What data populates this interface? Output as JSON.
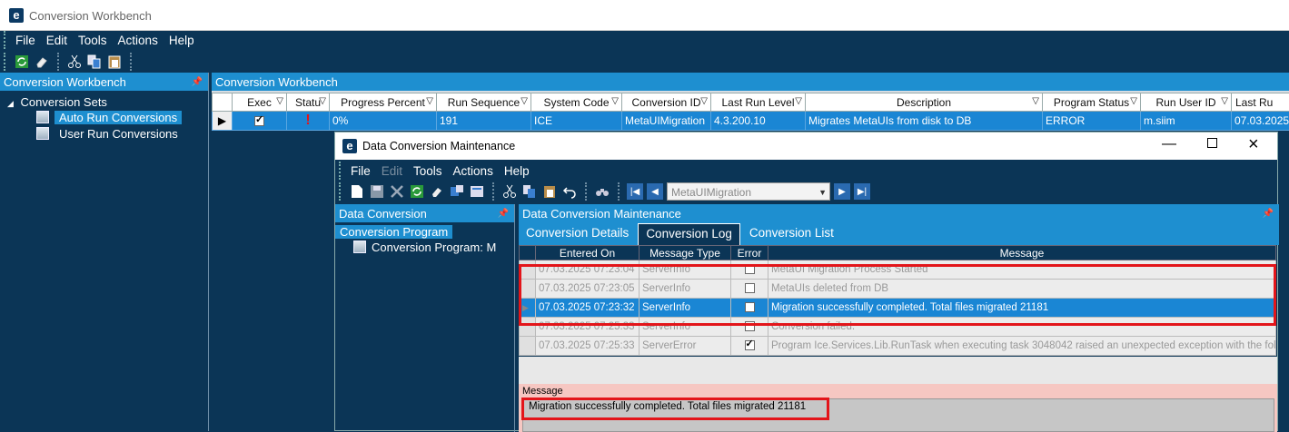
{
  "window": {
    "logo": "e",
    "title": "Conversion Workbench"
  },
  "menu": [
    "File",
    "Edit",
    "Tools",
    "Actions",
    "Help"
  ],
  "left_panel": {
    "title": "Conversion Workbench",
    "tree": {
      "root": "Conversion Sets",
      "items": [
        "Auto Run Conversions",
        "User Run Conversions"
      ]
    }
  },
  "main_panel": {
    "title": "Conversion Workbench",
    "columns": [
      "Exec",
      "Statu",
      "Progress Percent",
      "Run Sequence",
      "System Code",
      "Conversion ID",
      "Last Run Level",
      "Description",
      "Program Status",
      "Run User ID",
      "Last Ru"
    ],
    "row": {
      "progress": "0%",
      "run_sequence": "191",
      "system_code": "ICE",
      "conversion_id": "MetaUIMigration",
      "last_run_level": "4.3.200.10",
      "description": "Migrates MetaUIs from disk to DB",
      "program_status": "ERROR",
      "run_user_id": "m.siim",
      "last_run": "07.03.2025",
      "status_icon": "!"
    }
  },
  "dialog": {
    "logo": "e",
    "title": "Data Conversion Maintenance",
    "menu": [
      "File",
      "Edit",
      "Tools",
      "Actions",
      "Help"
    ],
    "nav_combo": "MetaUIMigration",
    "left": {
      "title": "Data Conversion",
      "root": "Conversion Program",
      "child": "Conversion Program: M"
    },
    "right_title": "Data Conversion Maintenance",
    "tabs": [
      "Conversion Details",
      "Conversion Log",
      "Conversion List"
    ],
    "log_columns": [
      "Entered On",
      "Message Type",
      "Error",
      "Message"
    ],
    "log_rows": [
      {
        "entered": "07.03.2025 07:23:04",
        "type": "ServerInfo",
        "error": false,
        "message": "MetaUI Migration Process Started"
      },
      {
        "entered": "07.03.2025 07:23:05",
        "type": "ServerInfo",
        "error": false,
        "message": "MetaUIs deleted from DB"
      },
      {
        "entered": "07.03.2025 07:23:32",
        "type": "ServerInfo",
        "error": false,
        "message": "Migration successfully completed. Total files migrated 21181"
      },
      {
        "entered": "07.03.2025 07:25:33",
        "type": "ServerInfo",
        "error": false,
        "message": "Conversion failed:"
      },
      {
        "entered": "07.03.2025 07:25:33",
        "type": "ServerError",
        "error": true,
        "message": "Program Ice.Services.Lib.RunTask when executing task 3048042 raised an unexpected exception with the foll"
      }
    ],
    "message_label": "Message",
    "message_value": "Migration successfully completed. Total files migrated 21181"
  },
  "colors": {
    "accent": "#1e8fd0",
    "dark": "#0b3556",
    "highlight": "#e3151a",
    "selected": "#1a86d4"
  }
}
